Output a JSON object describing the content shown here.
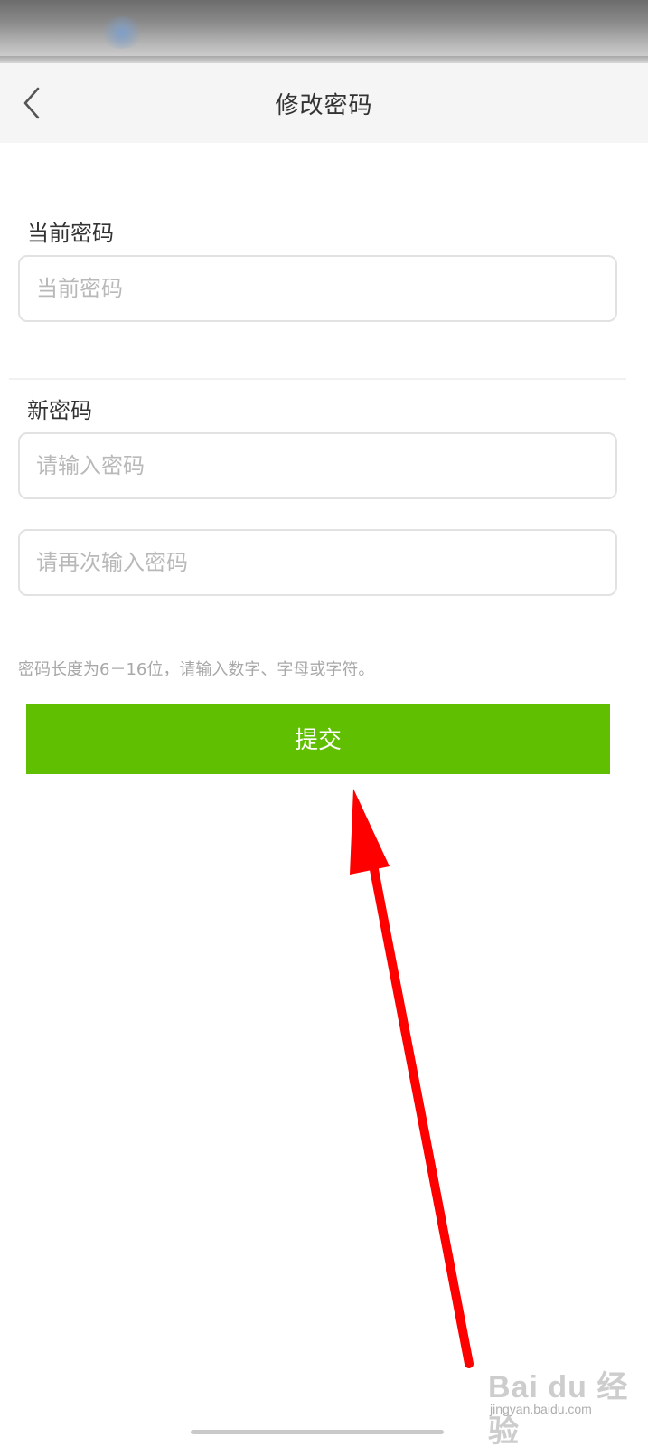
{
  "header": {
    "title": "修改密码",
    "back_icon": "chevron-left-icon"
  },
  "current_password": {
    "label": "当前密码",
    "placeholder": "当前密码",
    "value": ""
  },
  "new_password": {
    "label": "新密码",
    "placeholder": "请输入密码",
    "value": "",
    "confirm_placeholder": "请再次输入密码",
    "confirm_value": ""
  },
  "hint": "密码长度为6－16位，请输入数字、字母或字符。",
  "submit": {
    "label": "提交"
  },
  "colors": {
    "accent": "#5fbf00",
    "annotation_arrow": "#ff0000",
    "header_bg": "#f5f5f5"
  },
  "watermark": {
    "brand": "Bai du 经验",
    "url": "jingyan.baidu.com"
  }
}
